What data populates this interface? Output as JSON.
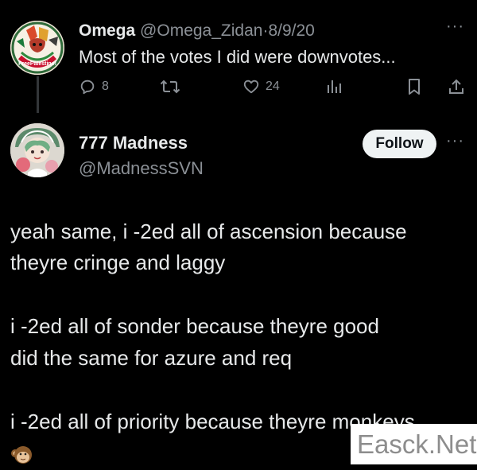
{
  "parent": {
    "name": "Omega",
    "handle": "@Omega_Zidan",
    "separator": "·",
    "date": "8/9/20",
    "more": "···",
    "text": "Most of the votes I did were downvotes...",
    "avatar_text": "FreePalestine!",
    "actions": {
      "reply_count": "8",
      "like_count": "24"
    }
  },
  "reply": {
    "name": "777 Madness",
    "handle": "@MadnessSVN",
    "follow_label": "Follow",
    "more": "···",
    "lines": [
      "yeah same, i -2ed all of ascension because",
      "theyre cringe and laggy",
      "i -2ed all of sonder because theyre good",
      "did the same for azure and req",
      "i -2ed all of priority because theyre monkeys"
    ],
    "emoji": "monkey-emoji"
  },
  "watermark": "Easck.Net",
  "colors": {
    "background": "#000000",
    "text": "#e7e9ea",
    "muted": "#8b9096",
    "follow_bg": "#eff3f4"
  }
}
